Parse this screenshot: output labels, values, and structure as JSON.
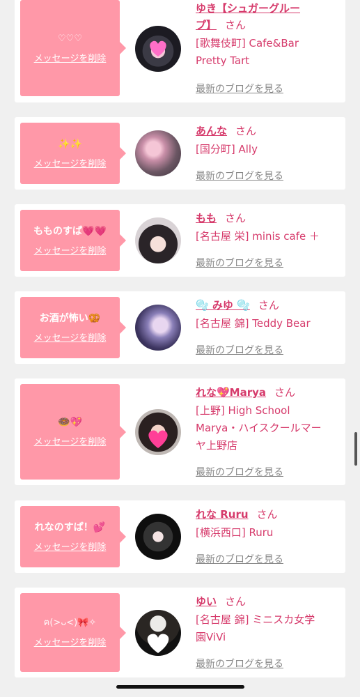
{
  "delete_label": "メッセージを削除",
  "san_label": "さん",
  "blog_label": "最新のブログを見る",
  "colors": {
    "accent": "#d63a6b",
    "bubble": "#ff98a8",
    "background": "#f0f0f0"
  },
  "cards": [
    {
      "message": "♡♡♡",
      "name": "ゆき【シュガーグループ】",
      "name_lines": [
        "ゆき【シュガーグルー",
        "プ】"
      ],
      "shop_lines": [
        "[歌舞伎町] Cafe&Bar",
        "Pretty Tart"
      ]
    },
    {
      "message": "✨✨",
      "name": "あんな",
      "shop_lines": [
        "[国分町] Ally"
      ]
    },
    {
      "message": "もものすぱ💗💗",
      "name": "もも",
      "shop_lines": [
        "[名古屋 栄] minis cafe ＋"
      ]
    },
    {
      "message": "お酒が怖い🥨",
      "name": "🫧 みゆ 🫧",
      "shop_lines": [
        "[名古屋 錦] Teddy Bear"
      ]
    },
    {
      "message": "🍩💖",
      "name": "れな💖Marya",
      "shop_lines": [
        "[上野] High School",
        "Marya・ハイスクールマー",
        "ヤ上野店"
      ]
    },
    {
      "message": "れなのすぱ！💕",
      "name": "れな Ruru",
      "shop_lines": [
        "[横浜西口] Ruru"
      ]
    },
    {
      "message": "ฅ(>ᴗ<)🎀✧",
      "name": "ゆい",
      "shop_lines": [
        "[名古屋 錦] ミニスカ女学",
        "園ViVi"
      ]
    }
  ]
}
